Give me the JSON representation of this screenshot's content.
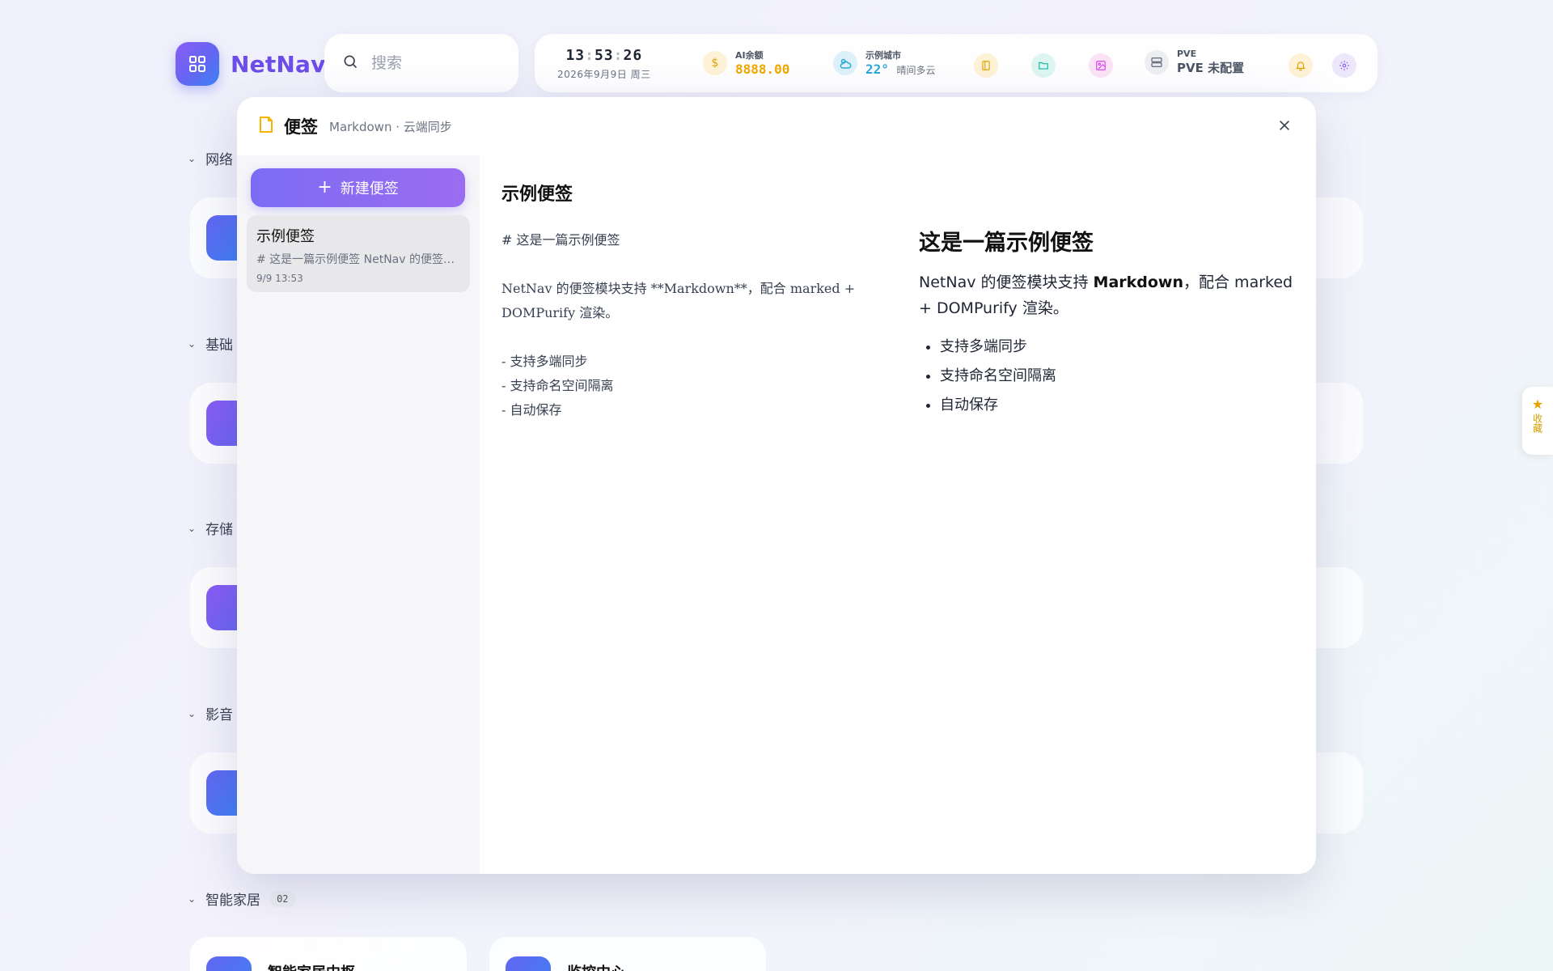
{
  "app": {
    "name": "NetNav"
  },
  "search": {
    "placeholder": "搜索"
  },
  "status": {
    "clock": {
      "h": "13",
      "m": "53",
      "s": "26",
      "date": "2026年9月9日  周三"
    },
    "ai": {
      "label": "AI余额",
      "value": "8888.00",
      "color": "#f4b400"
    },
    "weather": {
      "label": "示例城市",
      "temp": "22°",
      "desc": "晴间多云",
      "color": "#2aa9d6"
    },
    "pve": {
      "label": "PVE",
      "value": "PVE 未配置"
    }
  },
  "categories": [
    {
      "label": "网络",
      "count": ""
    },
    {
      "label": "基础",
      "count": ""
    },
    {
      "label": "存储",
      "count": ""
    },
    {
      "label": "影音",
      "count": ""
    },
    {
      "label": "智能家居",
      "count": "02"
    }
  ],
  "bottom_cards": [
    "智能家居中枢",
    "监控中心"
  ],
  "fav_tab": {
    "label": "收藏"
  },
  "modal": {
    "title": "便签",
    "subtitle": "Markdown · 云端同步",
    "new_button": "新建便签",
    "note": {
      "title": "示例便签",
      "preview": "# 这是一篇示例便签 NetNav 的便签模块支持 **Markdown**，配合 marked + DOMPurify 渲染。",
      "date": "9/9 13:53"
    },
    "editor_title": "示例便签",
    "source": "# 这是一篇示例便签\n\nNetNav 的便签模块支持 **Markdown**，配合 marked + DOMPurify 渲染。\n\n- 支持多端同步\n- 支持命名空间隔离\n- 自动保存",
    "preview": {
      "heading": "这是一篇示例便签",
      "p_before": "NetNav 的便签模块支持 ",
      "p_bold": "Markdown",
      "p_after": "，配合 marked + DOMPurify 渲染。",
      "items": [
        "支持多端同步",
        "支持命名空间隔离",
        "自动保存"
      ]
    }
  }
}
